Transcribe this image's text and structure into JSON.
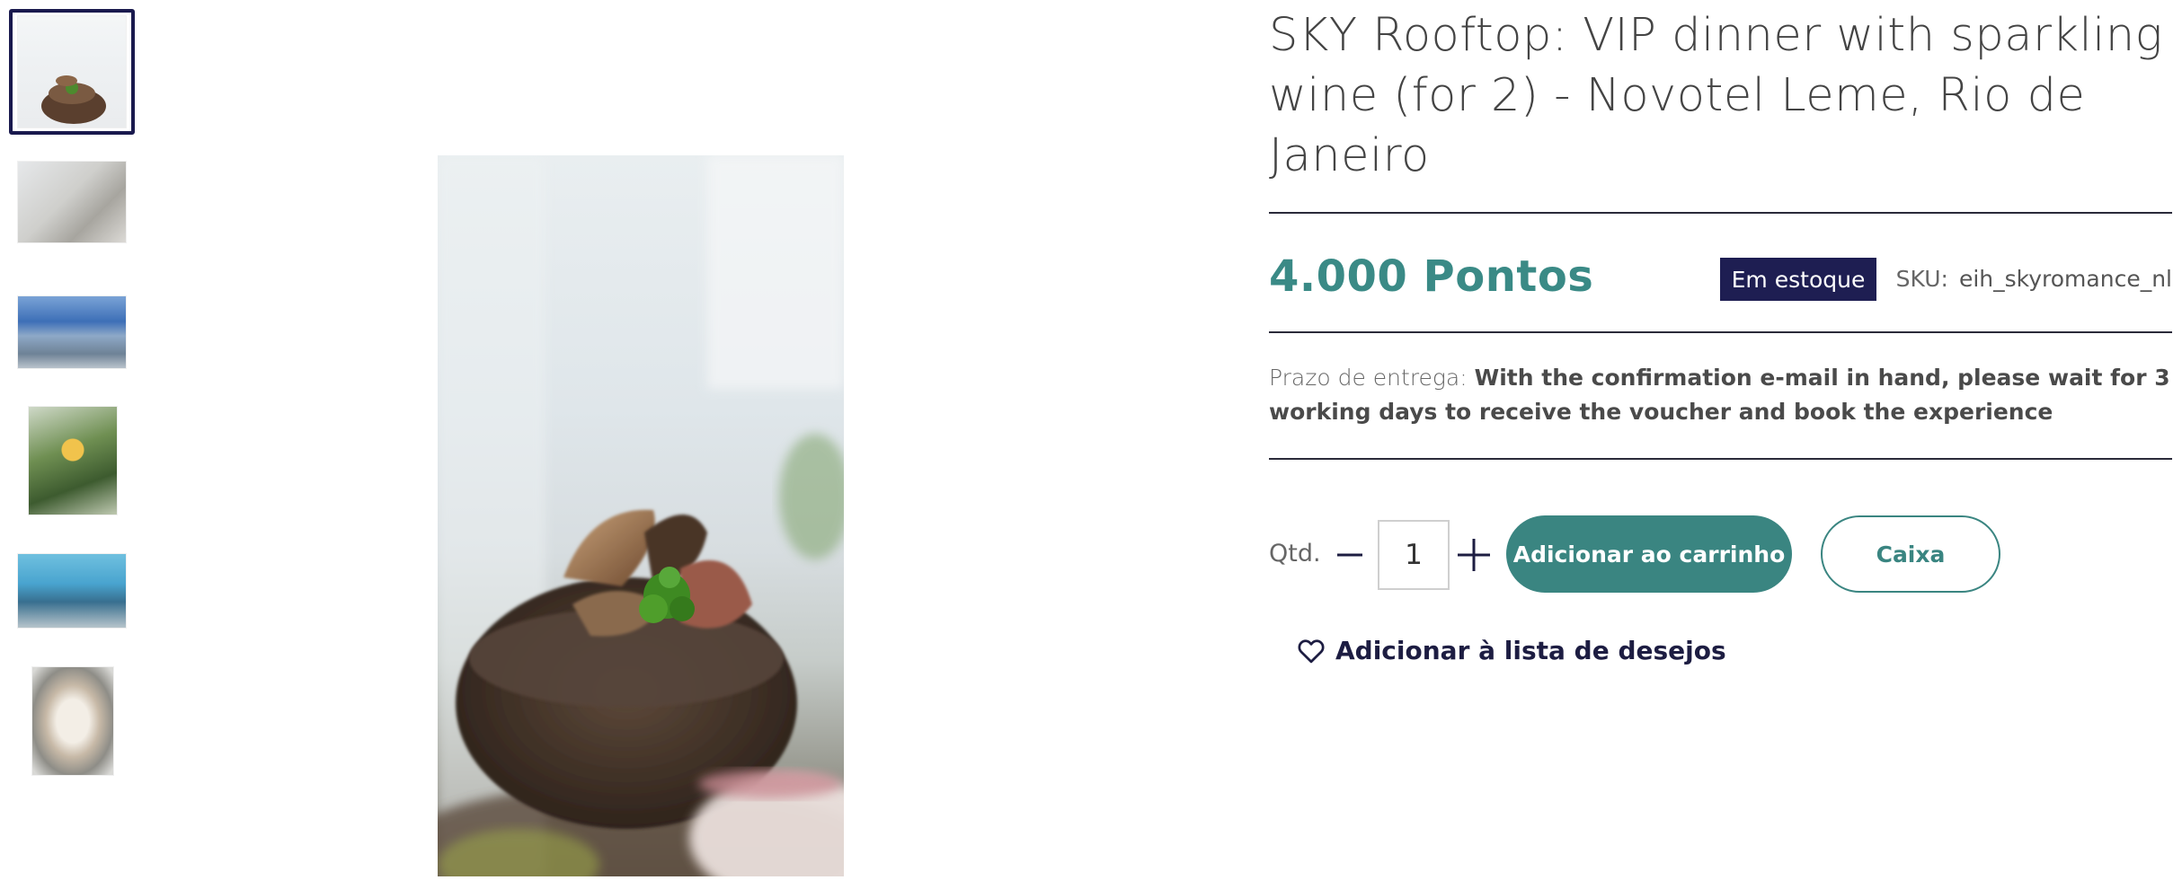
{
  "gallery": {
    "thumbnails": [
      {
        "icon": "thumbnail-image",
        "selected": true
      },
      {
        "icon": "thumbnail-image",
        "selected": false
      },
      {
        "icon": "thumbnail-image",
        "selected": false
      },
      {
        "icon": "thumbnail-image",
        "selected": false
      },
      {
        "icon": "thumbnail-image",
        "selected": false
      },
      {
        "icon": "thumbnail-image",
        "selected": false
      }
    ],
    "selected_border_color": "#1a1a4e"
  },
  "product": {
    "title": "SKY Rooftop: VIP dinner with sparkling wine (for 2) - Novotel Leme, Rio de Janeiro",
    "price": "4.000 Pontos",
    "stock_badge": "Em estoque",
    "sku_label": "SKU:",
    "sku_value": "eih_skyromance_nl",
    "delivery_label": "Prazo de entrega:",
    "delivery_value": "With the confirmation e-mail in hand, please wait for 3 working days to receive the voucher and book the experience"
  },
  "purchase": {
    "qty_label": "Qtd.",
    "qty_value": "1",
    "minus_icon": "minus-icon",
    "plus_icon": "plus-icon",
    "add_to_cart_label": "Adicionar ao carrinho",
    "checkout_label": "Caixa",
    "wishlist_label": "Adicionar à lista de desejos",
    "wishlist_icon": "heart-icon"
  },
  "colors": {
    "accent": "#3a8581",
    "price": "#3a8a86",
    "badge_bg": "#1e1e52",
    "text_dark": "#1d1d42"
  }
}
